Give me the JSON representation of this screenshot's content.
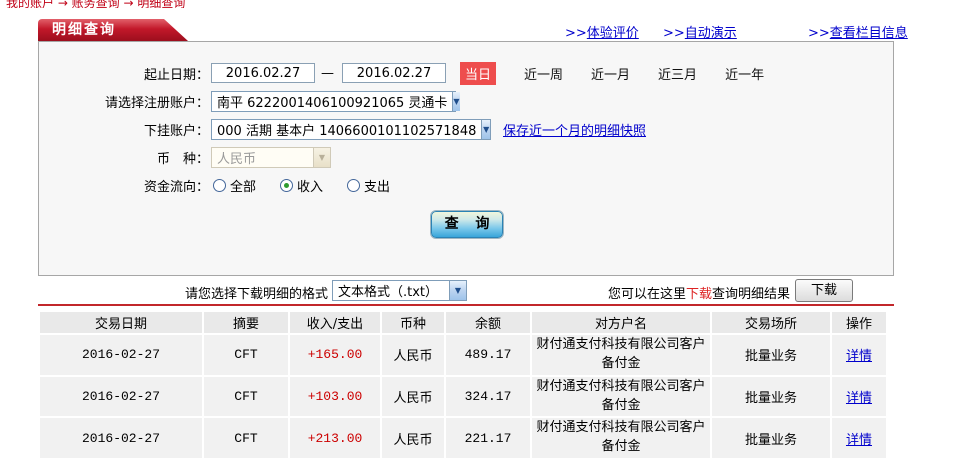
{
  "breadcrumb": {
    "text": "我的账户 → 账务查询 → 明细查询"
  },
  "header": {
    "tab_title": "明细查询",
    "links": [
      {
        "prefix": ">>",
        "label": "体验评价"
      },
      {
        "prefix": ">>",
        "label": "自动演示"
      },
      {
        "prefix": ">>",
        "label": "查看栏目信息"
      }
    ]
  },
  "form": {
    "date_label": "起止日期：",
    "date_from": "2016.02.27",
    "date_to": "2016.02.27",
    "date_separator": "—",
    "quick_today": "当日",
    "quick_ranges": [
      "近一周",
      "近一月",
      "近三月",
      "近一年"
    ],
    "register_account_label": "请选择注册账户：",
    "register_account_value": "南平  6222001406100921065  灵通卡",
    "sub_account_label": "下挂账户：",
    "sub_account_value": "000  活期  基本户  1406600101102571848",
    "snapshot_link": "保存近一个月的明细快照",
    "currency_label": "币　种：",
    "currency_value": "人民币",
    "flow_label": "资金流向：",
    "flow_options": [
      {
        "label": "全部",
        "checked": false
      },
      {
        "label": "收入",
        "checked": true
      },
      {
        "label": "支出",
        "checked": false
      }
    ],
    "query_button": "查 询"
  },
  "download": {
    "format_label": "请您选择下载明细的格式",
    "format_value": "文本格式（.txt）",
    "hint_prefix": "您可以在这里",
    "hint_link": "下载",
    "hint_suffix": "查询明细结果",
    "button_label": "下载"
  },
  "table": {
    "headers": [
      "交易日期",
      "摘要",
      "收入/支出",
      "币种",
      "余额",
      "对方户名",
      "交易场所",
      "操作"
    ],
    "rows": [
      {
        "date": "2016-02-27",
        "summary": "CFT",
        "amount": "+165.00",
        "currency": "人民币",
        "balance": "489.17",
        "counterparty": "财付通支付科技有限公司客户备付金",
        "venue": "批量业务",
        "action": "详情"
      },
      {
        "date": "2016-02-27",
        "summary": "CFT",
        "amount": "+103.00",
        "currency": "人民币",
        "balance": "324.17",
        "counterparty": "财付通支付科技有限公司客户备付金",
        "venue": "批量业务",
        "action": "详情"
      },
      {
        "date": "2016-02-27",
        "summary": "CFT",
        "amount": "+213.00",
        "currency": "人民币",
        "balance": "221.17",
        "counterparty": "财付通支付科技有限公司客户备付金",
        "venue": "批量业务",
        "action": "详情"
      }
    ]
  },
  "colors": {
    "tab_red": "#c2182a",
    "badge_red": "#ee4d4d",
    "amount_red": "#cc0000",
    "link_blue": "#0000cc",
    "divider_red": "#c2272b"
  }
}
